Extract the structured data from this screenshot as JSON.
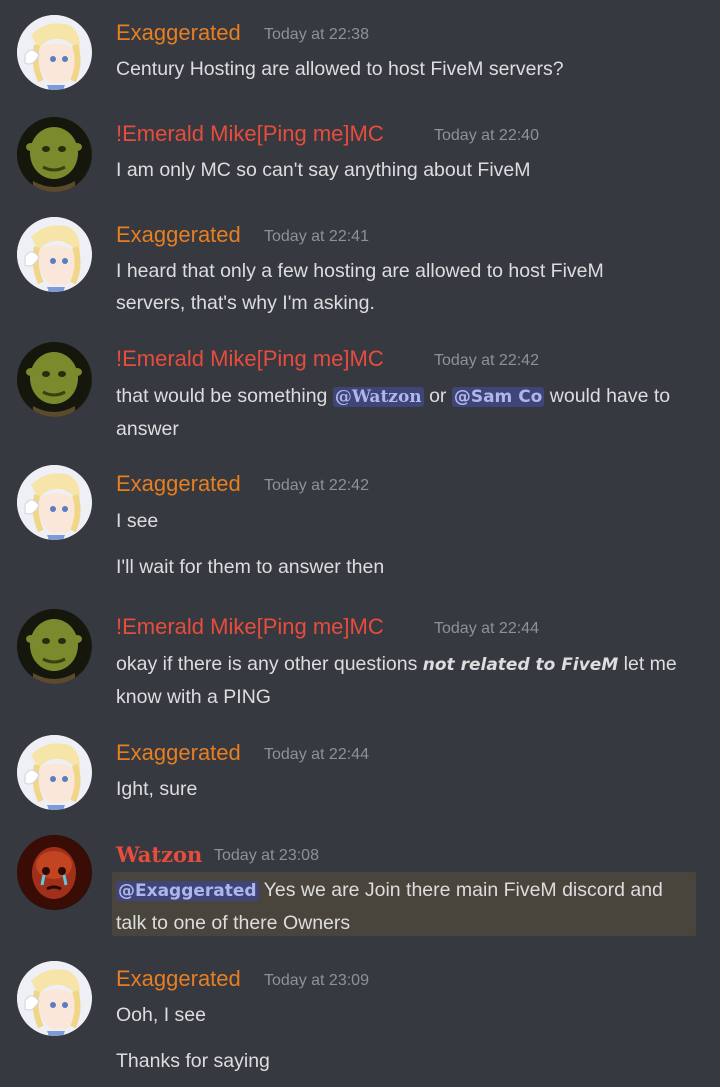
{
  "colors": {
    "background": "#36393f",
    "exaggerated": "#e67e22",
    "emerald": "#e74c3c",
    "watzon": "#e74c3c",
    "timestamp": "#8e9297",
    "mention_bg": "#3f4676",
    "highlight_bg": "#49443c"
  },
  "messages": [
    {
      "author": "Exaggerated",
      "time": "Today at 22:38",
      "lines": [
        "Century Hosting are allowed to host FiveM servers?"
      ]
    },
    {
      "author": "!Emerald Mike[Ping me]MC",
      "time": "Today at 22:40",
      "lines": [
        "I am only MC so can't say anything about FiveM"
      ]
    },
    {
      "author": "Exaggerated",
      "time": "Today at 22:41",
      "lines": [
        "I heard that only a few hosting are allowed to host FiveM servers, that's why I'm asking."
      ]
    },
    {
      "author": "!Emerald Mike[Ping me]MC",
      "time": "Today at 22:42",
      "parts": {
        "pre": "that would be something ",
        "mention1": "@Watzon",
        "mid": " or ",
        "mention2": "@Sam Co",
        "post": " would have to answer"
      }
    },
    {
      "author": "Exaggerated",
      "time": "Today at 22:42",
      "lines": [
        "I see",
        "I'll wait for them to answer then"
      ]
    },
    {
      "author": "!Emerald Mike[Ping me]MC",
      "time": "Today at 22:44",
      "parts": {
        "pre": "okay if there is any other questions ",
        "emph": "not related to FiveM",
        "post": " let me know with a PING"
      }
    },
    {
      "author": "Exaggerated",
      "time": "Today at 22:44",
      "lines": [
        "Ight, sure"
      ]
    },
    {
      "author": "Watzon",
      "time": "Today at 23:08",
      "parts": {
        "mention": "@Exaggerated",
        "post": " Yes we are Join there main FiveM discord and talk to one of there Owners"
      }
    },
    {
      "author": "Exaggerated",
      "time": "Today at 23:09",
      "lines": [
        "Ooh, I see",
        "Thanks for saying"
      ]
    }
  ]
}
